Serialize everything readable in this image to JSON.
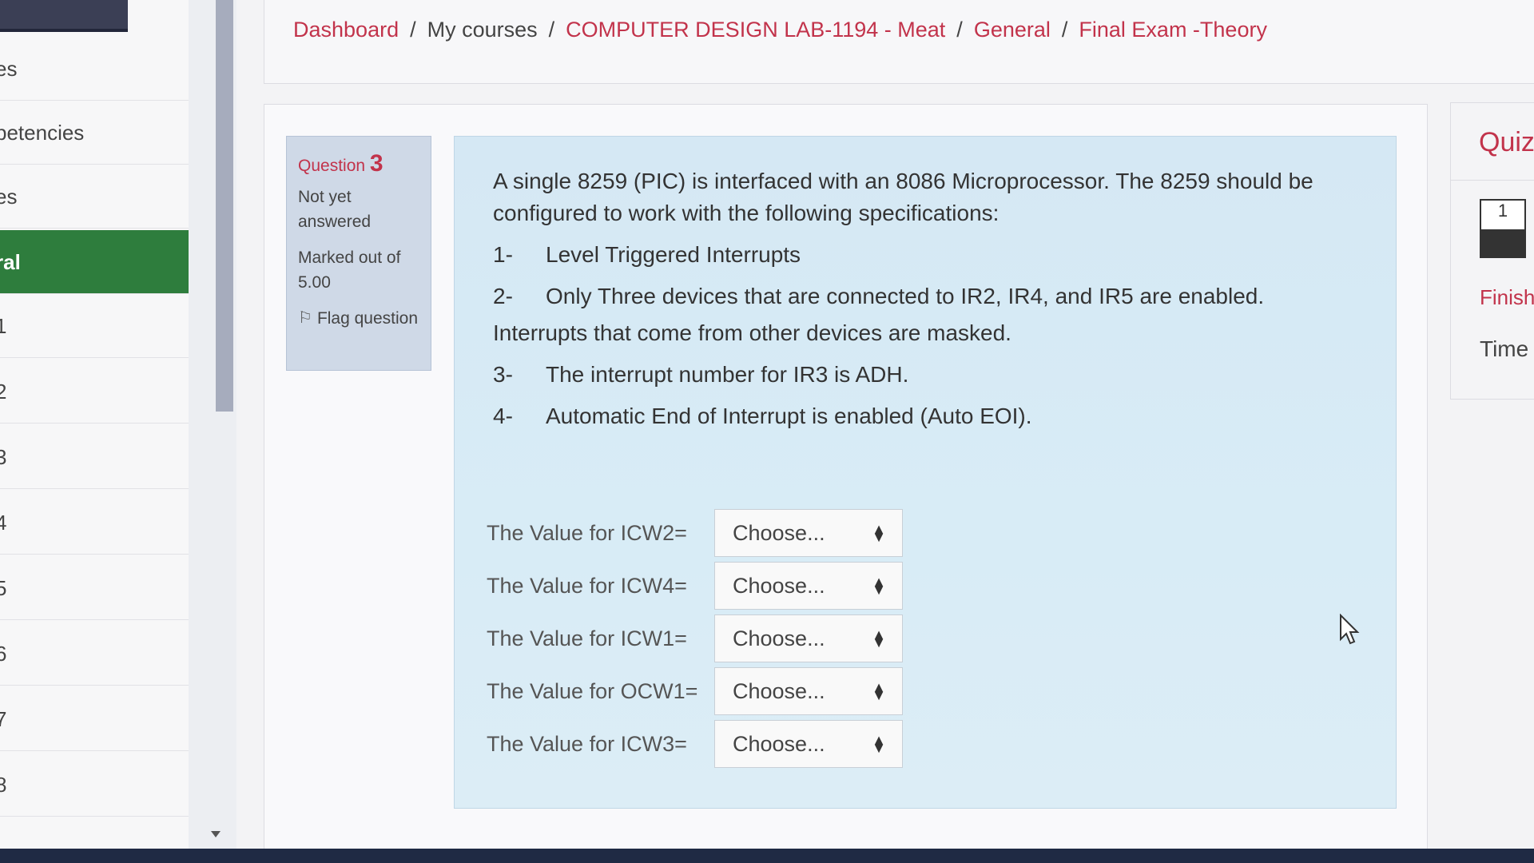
{
  "sidebar": {
    "items": [
      {
        "label": "es",
        "active": false
      },
      {
        "label": "petencies",
        "active": false
      },
      {
        "label": "es",
        "active": false
      },
      {
        "label": "ral",
        "active": true
      },
      {
        "label": "1",
        "active": false
      },
      {
        "label": "2",
        "active": false
      },
      {
        "label": "3",
        "active": false
      },
      {
        "label": "4",
        "active": false
      },
      {
        "label": "5",
        "active": false
      },
      {
        "label": "6",
        "active": false
      },
      {
        "label": "7",
        "active": false
      },
      {
        "label": "8",
        "active": false
      }
    ]
  },
  "breadcrumb": {
    "items": [
      "Dashboard",
      "My courses",
      "COMPUTER DESIGN LAB-1194 - Meat",
      "General",
      "Final Exam -Theory"
    ],
    "separator": "/"
  },
  "question_info": {
    "label": "Question",
    "number": "3",
    "status": "Not yet answered",
    "mark": "Marked out of 5.00",
    "flag_label": "Flag question"
  },
  "question": {
    "intro": "A single 8259 (PIC) is interfaced with an 8086 Microprocessor. The 8259 should be configured to work with the following specifications:",
    "specs": [
      {
        "num": "1-",
        "text": "Level Triggered Interrupts"
      },
      {
        "num": "2-",
        "text": "Only Three devices that are connected to IR2, IR4, and IR5 are enabled.",
        "continuation": "Interrupts that come from other devices are masked."
      },
      {
        "num": "3-",
        "text": "The interrupt number for IR3 is ADH."
      },
      {
        "num": "4-",
        "text": "Automatic End of Interrupt is enabled (Auto EOI)."
      }
    ],
    "answers": [
      {
        "label": "The Value for ICW2=",
        "value": "Choose..."
      },
      {
        "label": "The Value for ICW4=",
        "value": "Choose..."
      },
      {
        "label": "The Value for ICW1=",
        "value": "Choose..."
      },
      {
        "label": "The Value for OCW1=",
        "value": "Choose..."
      },
      {
        "label": "The Value for ICW3=",
        "value": "Choose..."
      }
    ]
  },
  "quiz_nav": {
    "title": "Quiz",
    "button_number": "1",
    "finish_label": "Finish",
    "time_label": "Time"
  },
  "colors": {
    "accent": "#c2334b",
    "sidebar_active": "#2e7d3d",
    "question_bg": "#d5e8f4"
  }
}
